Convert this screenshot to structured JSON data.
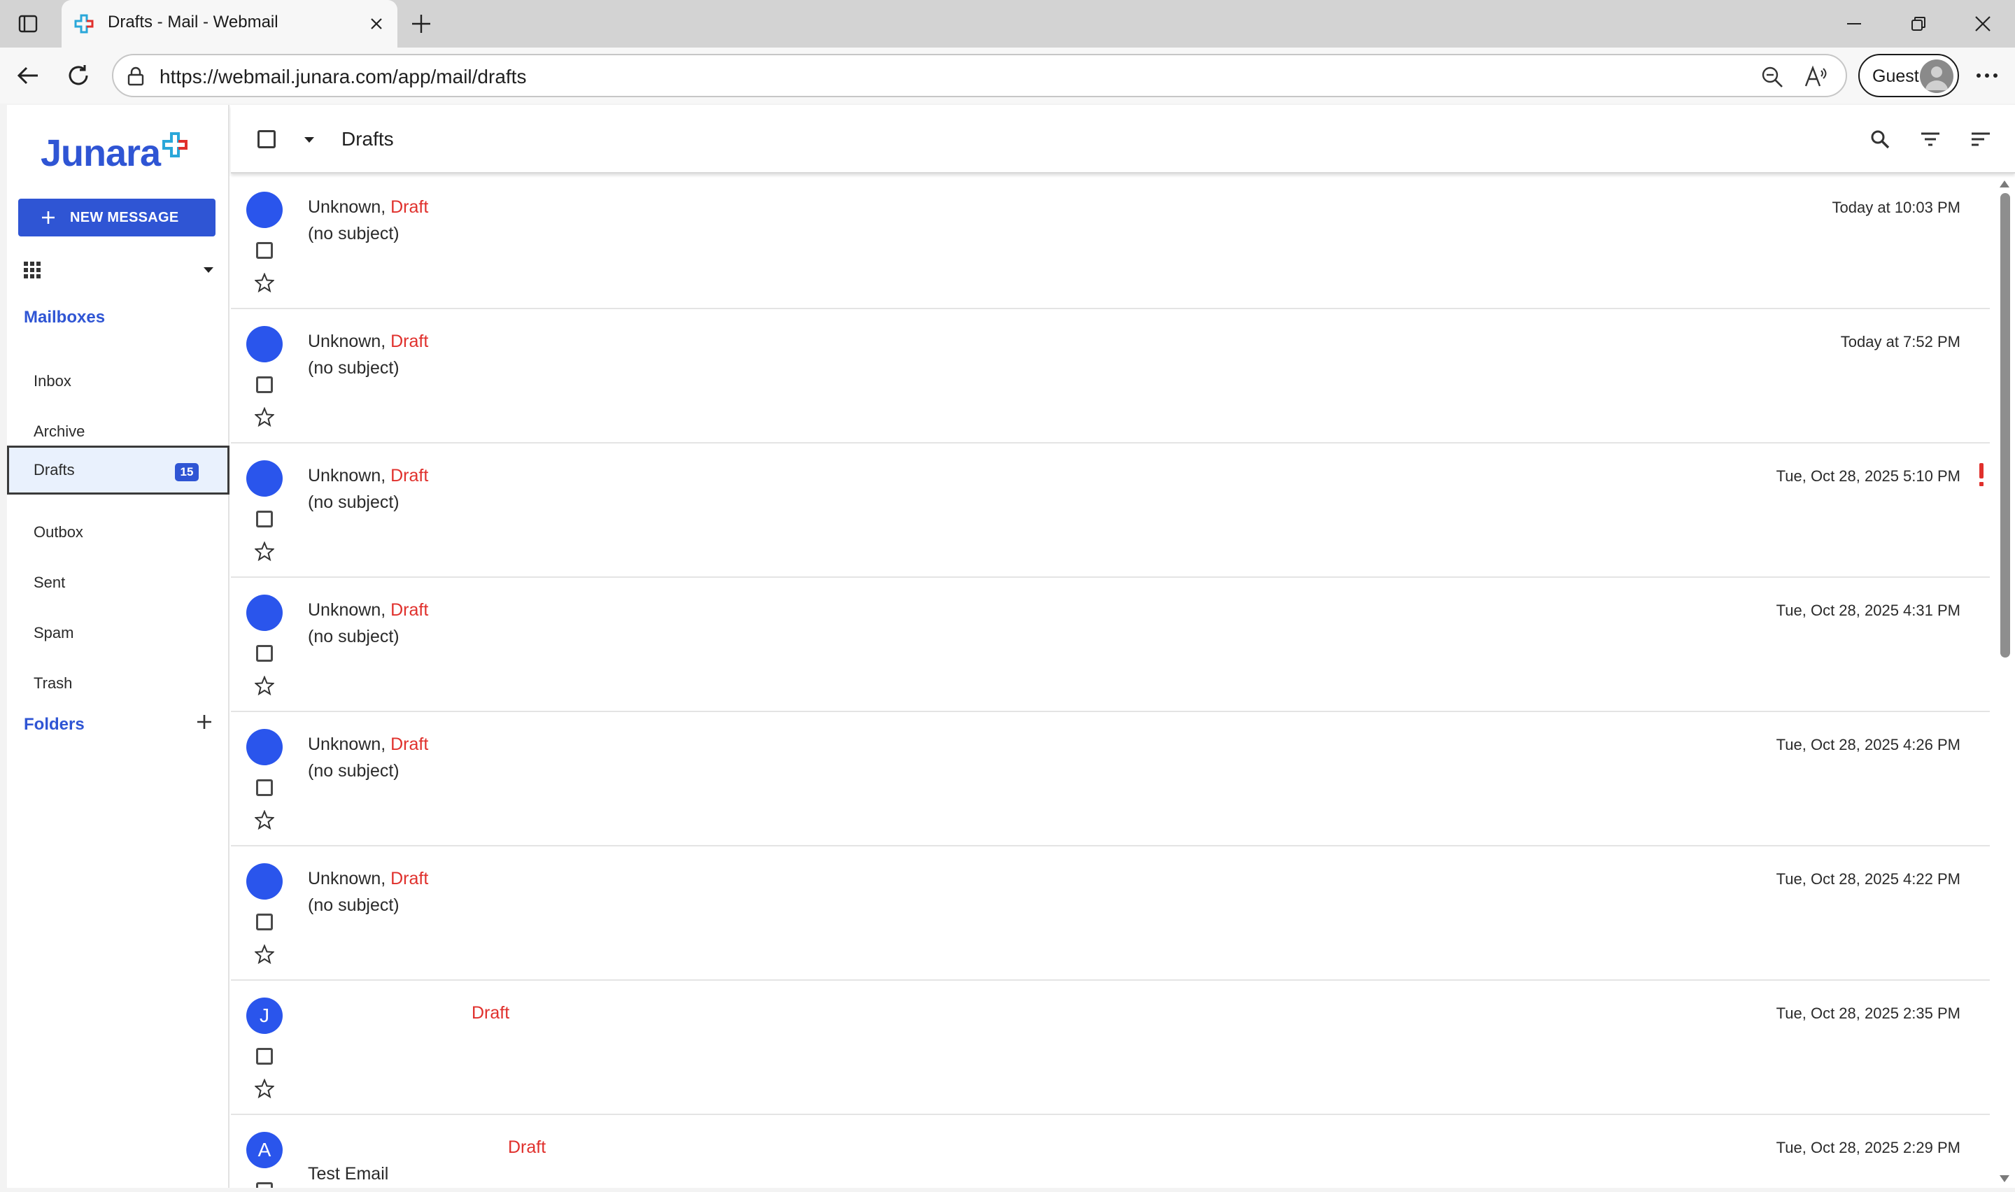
{
  "browser": {
    "tab_title": "Drafts - Mail - Webmail",
    "url": "https://webmail.junara.com/app/mail/drafts",
    "profile_label": "Guest"
  },
  "app": {
    "logo_text": "Junara",
    "brand_color": "#2f55d4",
    "new_message_label": "NEW MESSAGE",
    "mailboxes_title": "Mailboxes",
    "mailboxes": [
      {
        "label": "Inbox"
      },
      {
        "label": "Archive"
      },
      {
        "label": "Drafts",
        "badge": "15",
        "active": true
      },
      {
        "label": "Outbox"
      },
      {
        "label": "Sent"
      },
      {
        "label": "Spam"
      },
      {
        "label": "Trash"
      }
    ],
    "folders_title": "Folders"
  },
  "header": {
    "title": "Drafts"
  },
  "messages": [
    {
      "sender": "Unknown,",
      "tag": "Draft",
      "subject": "(no subject)",
      "date": "Today at 10:03 PM",
      "avatar": "",
      "flagged": false
    },
    {
      "sender": "Unknown,",
      "tag": "Draft",
      "subject": "(no subject)",
      "date": "Today at 7:52 PM",
      "avatar": "",
      "flagged": false
    },
    {
      "sender": "Unknown,",
      "tag": "Draft",
      "subject": "(no subject)",
      "date": "Tue, Oct 28, 2025 5:10 PM",
      "avatar": "",
      "flagged": true
    },
    {
      "sender": "Unknown,",
      "tag": "Draft",
      "subject": "(no subject)",
      "date": "Tue, Oct 28, 2025 4:31 PM",
      "avatar": "",
      "flagged": false
    },
    {
      "sender": "Unknown,",
      "tag": "Draft",
      "subject": "(no subject)",
      "date": "Tue, Oct 28, 2025 4:26 PM",
      "avatar": "",
      "flagged": false
    },
    {
      "sender": "Unknown,",
      "tag": "Draft",
      "subject": "(no subject)",
      "date": "Tue, Oct 28, 2025 4:22 PM",
      "avatar": "",
      "flagged": false
    },
    {
      "sender": "",
      "tag": "Draft",
      "subject": "",
      "date": "Tue, Oct 28, 2025 2:35 PM",
      "avatar": "J",
      "flagged": false
    },
    {
      "sender": "",
      "tag": "Draft",
      "subject": "Test Email",
      "date": "Tue, Oct 28, 2025 2:29 PM",
      "avatar": "A",
      "flagged": false
    }
  ],
  "colors": {
    "avatar": "#2a55ec",
    "draft_tag": "#e0302c",
    "flag": "#e0302c",
    "selected_bg": "#e9f1fd"
  }
}
